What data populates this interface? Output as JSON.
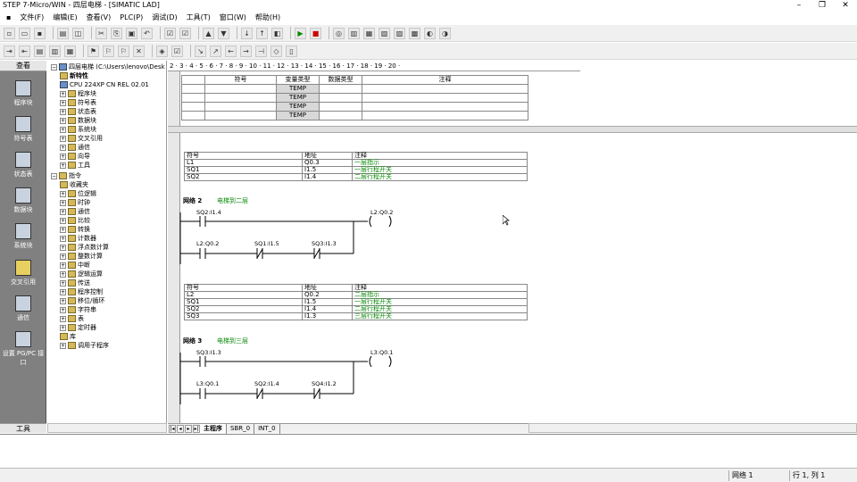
{
  "window": {
    "title": "STEP 7-Micro/WIN - 四层电梯 - [SIMATIC LAD]"
  },
  "menu": [
    "文件(F)",
    "编辑(E)",
    "查看(V)",
    "PLC(P)",
    "调试(D)",
    "工具(T)",
    "窗口(W)",
    "帮助(H)"
  ],
  "nav": {
    "header": "查看",
    "footer": "工具",
    "items": [
      "程序块",
      "符号表",
      "状态表",
      "数据块",
      "系统块",
      "交叉引用",
      "通信",
      "设置 PG/PC 接口"
    ]
  },
  "tree": {
    "root": "四层电梯 (C:\\Users\\lenovo\\Desk",
    "items": [
      "新特性",
      "CPU 224XP CN REL 02.01",
      "程序块",
      "符号表",
      "状态表",
      "数据块",
      "系统块",
      "交叉引用",
      "通信",
      "向导",
      "工具",
      "指令",
      "收藏夹",
      "位逻辑",
      "时钟",
      "通信",
      "比较",
      "转换",
      "计数器",
      "浮点数计算",
      "整数计算",
      "中断",
      "逻辑运算",
      "传送",
      "程序控制",
      "移位/循环",
      "字符串",
      "表",
      "定时器",
      "库",
      "调用子程序"
    ]
  },
  "ruler": "2 · 3 · 4 · 5 · 6 · 7 · 8 · 9 · 10 · 11 · 12 · 13 · 14 · 15 · 16 · 17 · 18 · 19 · 20 ·",
  "var_table": {
    "headers": [
      "符号",
      "变量类型",
      "数据类型",
      "注释"
    ],
    "rows": [
      "TEMP",
      "TEMP",
      "TEMP",
      "TEMP"
    ]
  },
  "sym1": {
    "headers": [
      "符号",
      "地址",
      "注释"
    ],
    "rows": [
      [
        "L1",
        "Q0.3",
        "一层指示"
      ],
      [
        "SQ1",
        "I1.5",
        "一层行程开关"
      ],
      [
        "SQ2",
        "I1.4",
        "二层行程开关"
      ]
    ]
  },
  "network2": {
    "title": "网络 2",
    "comment": "电梯到二层",
    "c1": "SQ2:I1.4",
    "coil": "L2:Q0.2",
    "c2": "L2:Q0.2",
    "c3": "SQ1:I1.5",
    "c4": "SQ3:I1.3"
  },
  "sym2": {
    "headers": [
      "符号",
      "地址",
      "注释"
    ],
    "rows": [
      [
        "L2",
        "Q0.2",
        "二层指示"
      ],
      [
        "SQ1",
        "I1.5",
        "一层行程开关"
      ],
      [
        "SQ2",
        "I1.4",
        "二层行程开关"
      ],
      [
        "SQ3",
        "I1.3",
        "三层行程开关"
      ]
    ]
  },
  "network3": {
    "title": "网络 3",
    "comment": "电梯到三层",
    "c1": "SQ3:I1.3",
    "coil": "L3:Q0.1",
    "c2": "L3:Q0.1",
    "c3": "SQ2:I1.4",
    "c4": "SQ4:I1.2"
  },
  "tabs": [
    "主程序",
    "SBR_0",
    "INT_0"
  ],
  "status": {
    "network": "网络 1",
    "pos": "行 1, 列 1"
  }
}
